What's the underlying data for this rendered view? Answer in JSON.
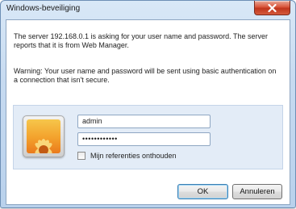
{
  "window": {
    "title": "Windows-beveiliging"
  },
  "message": {
    "line1": "The server 192.168.0.1 is asking for your user name and password. The server reports that it is from Web Manager.",
    "line2": "Warning: Your user name and password will be sent using basic authentication on a connection that isn't secure."
  },
  "credentials": {
    "username": "admin",
    "password_masked": "••••••••••••",
    "remember_label": "Mijn referenties onthouden",
    "remember_checked": false
  },
  "buttons": {
    "ok": "OK",
    "cancel": "Annuleren"
  },
  "icons": {
    "close": "close-icon",
    "user_tile": "flower-user-tile-icon"
  },
  "colors": {
    "close_button": "#c0351c",
    "panel": "#e3ecf7",
    "frame": "#c6daf0"
  }
}
